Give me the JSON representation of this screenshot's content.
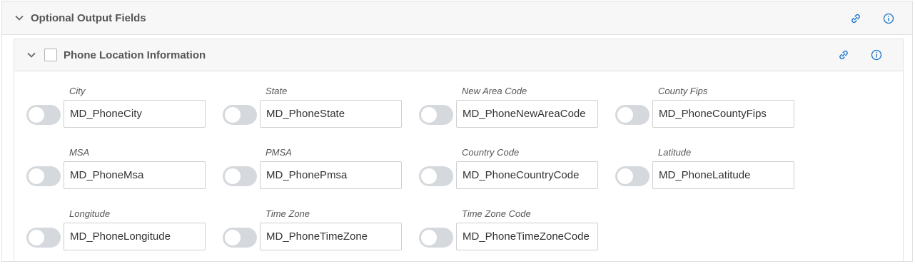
{
  "section": {
    "title": "Optional Output Fields"
  },
  "group": {
    "title": "Phone Location Information",
    "checked": false
  },
  "fields": [
    {
      "label": "City",
      "value": "MD_PhoneCity",
      "enabled": false
    },
    {
      "label": "State",
      "value": "MD_PhoneState",
      "enabled": false
    },
    {
      "label": "New Area Code",
      "value": "MD_PhoneNewAreaCode",
      "enabled": false
    },
    {
      "label": "County Fips",
      "value": "MD_PhoneCountyFips",
      "enabled": false
    },
    {
      "label": "MSA",
      "value": "MD_PhoneMsa",
      "enabled": false
    },
    {
      "label": "PMSA",
      "value": "MD_PhonePmsa",
      "enabled": false
    },
    {
      "label": "Country Code",
      "value": "MD_PhoneCountryCode",
      "enabled": false
    },
    {
      "label": "Latitude",
      "value": "MD_PhoneLatitude",
      "enabled": false
    },
    {
      "label": "Longitude",
      "value": "MD_PhoneLongitude",
      "enabled": false
    },
    {
      "label": "Time Zone",
      "value": "MD_PhoneTimeZone",
      "enabled": false
    },
    {
      "label": "Time Zone Code",
      "value": "MD_PhoneTimeZoneCode",
      "enabled": false
    }
  ],
  "icons": {
    "collapse": "chevron-down-icon",
    "link": "link-icon",
    "info": "info-icon"
  },
  "colors": {
    "accent": "#1a73c8",
    "toggle_off": "#d5d9dd",
    "header_bg": "#f7f7f7"
  }
}
